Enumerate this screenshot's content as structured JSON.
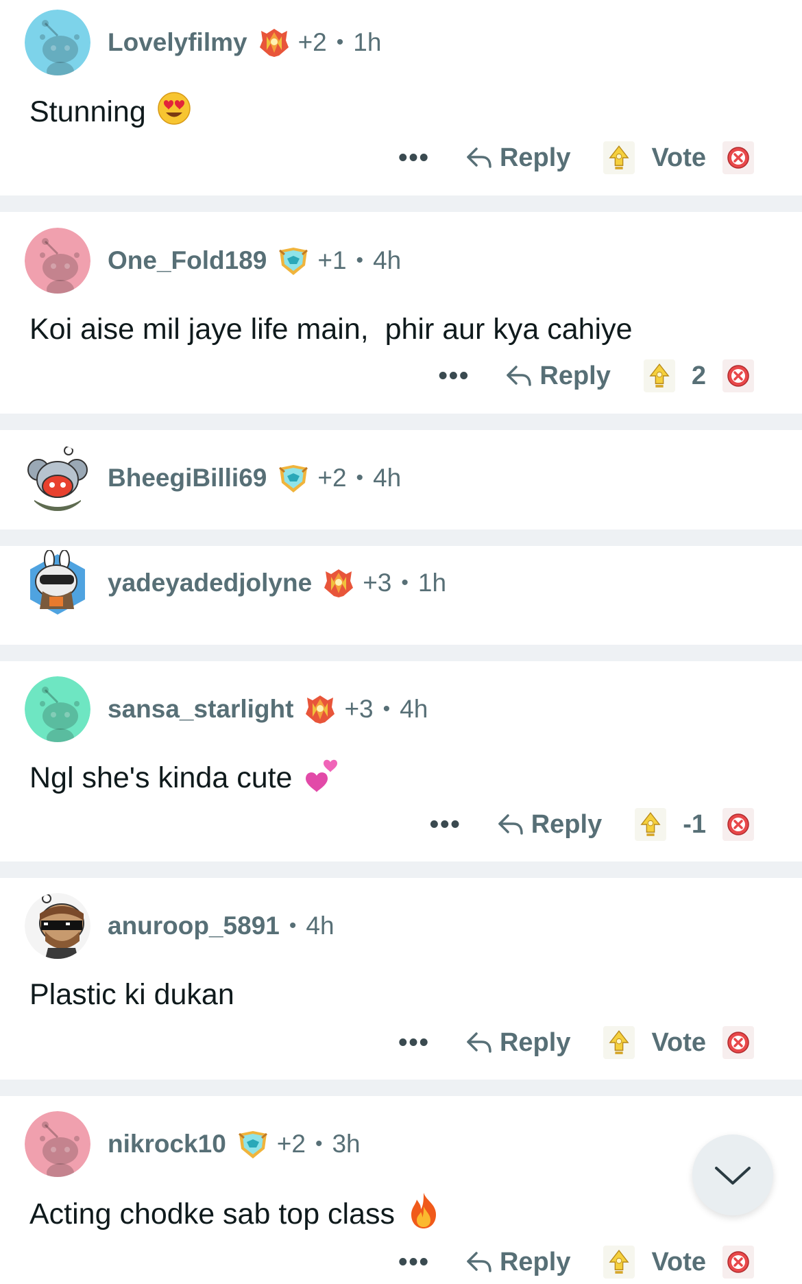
{
  "colors": {
    "separator": "#eef1f4",
    "meta_text": "#576f76",
    "body_text": "#0f1a1c"
  },
  "actions": {
    "more": "•••",
    "reply": "Reply"
  },
  "comments": [
    {
      "username": "Lovelyfilmy",
      "badge": "crystal-badge",
      "extra": "+2",
      "dot": "•",
      "age": "1h",
      "avatar": "snoo-blue",
      "text": "Stunning",
      "emoji": "heart-eyes",
      "vote": "Vote"
    },
    {
      "username": "One_Fold189",
      "badge": "shield-badge",
      "extra": "+1",
      "dot": "•",
      "age": "4h",
      "avatar": "snoo-pink",
      "text": "Koi aise mil jaye life main,  phir aur kya cahiye",
      "vote": "2"
    },
    {
      "username": "BheegiBilli69",
      "badge": "shield-badge",
      "extra": "+2",
      "dot": "•",
      "age": "4h",
      "avatar": "koala-snoo"
    },
    {
      "username": "yadeyadedjolyne",
      "badge": "crystal-badge",
      "extra": "+3",
      "dot": "•",
      "age": "1h",
      "avatar": "bunny-snoo"
    },
    {
      "username": "sansa_starlight",
      "badge": "crystal-badge",
      "extra": "+3",
      "dot": "•",
      "age": "4h",
      "avatar": "snoo-green",
      "text": "Ngl she's kinda cute",
      "emoji": "two-hearts",
      "vote": "-1"
    },
    {
      "username": "anuroop_5891",
      "dot": "•",
      "age": "4h",
      "avatar": "sunglasses-snoo",
      "text": "Plastic ki dukan",
      "vote": "Vote"
    },
    {
      "username": "nikrock10",
      "badge": "shield-badge",
      "extra": "+2",
      "dot": "•",
      "age": "3h",
      "avatar": "snoo-pink",
      "text": "Acting chodke sab top class",
      "emoji": "fire",
      "vote": "Vote"
    }
  ],
  "scroll_button": {
    "icon": "chevron-down-icon"
  }
}
